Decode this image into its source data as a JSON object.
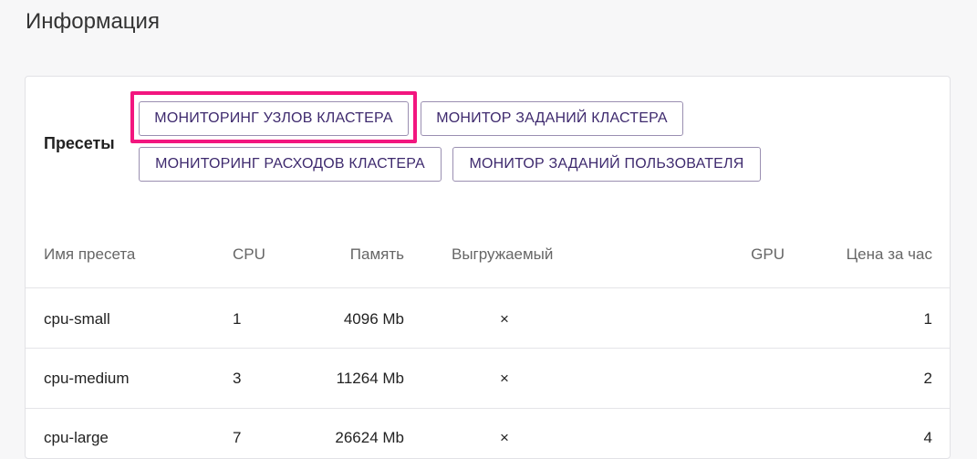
{
  "page": {
    "title": "Информация"
  },
  "presets": {
    "label": "Пресеты",
    "buttons": [
      "МОНИТОРИНГ УЗЛОВ КЛАСТЕРА",
      "МОНИТОР ЗАДАНИЙ КЛАСТЕРА",
      "МОНИТОРИНГ РАСХОДОВ КЛАСТЕРА",
      "МОНИТОР ЗАДАНИЙ ПОЛЬЗОВАТЕЛЯ"
    ]
  },
  "table": {
    "headers": [
      "Имя пресета",
      "CPU",
      "Память",
      "Выгружаемый",
      "GPU",
      "Цена за час"
    ],
    "rows": [
      {
        "name": "cpu-small",
        "cpu": "1",
        "memory": "4096 Mb",
        "preemptible": "×",
        "gpu": "",
        "price": "1"
      },
      {
        "name": "cpu-medium",
        "cpu": "3",
        "memory": "11264 Mb",
        "preemptible": "×",
        "gpu": "",
        "price": "2"
      },
      {
        "name": "cpu-large",
        "cpu": "7",
        "memory": "26624 Mb",
        "preemptible": "×",
        "gpu": "",
        "price": "4"
      }
    ]
  },
  "colors": {
    "highlight": "#f2167f",
    "button_text": "#3e2a6e",
    "button_border": "#9a8fb1"
  }
}
